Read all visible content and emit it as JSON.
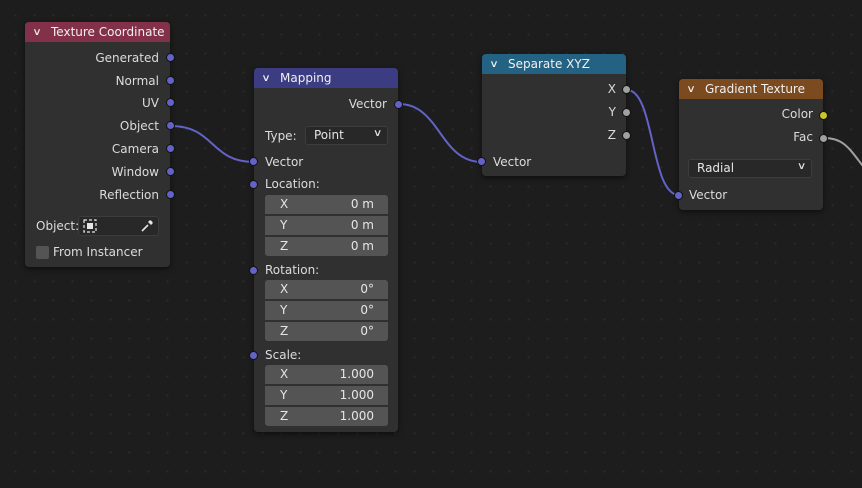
{
  "colors": {
    "texcoord_header": "#83314a",
    "mapping_header": "#3c3c83",
    "separate_header": "#246283",
    "gradient_header": "#7b4a1f",
    "vector_socket": "#6363c7",
    "float_socket": "#a1a1a1",
    "color_socket": "#c7c729",
    "link_vector": "#6363c7",
    "link_float": "#a1a1a1"
  },
  "nodes": {
    "texture_coordinate": {
      "title": "Texture Coordinate",
      "outputs": [
        "Generated",
        "Normal",
        "UV",
        "Object",
        "Camera",
        "Window",
        "Reflection"
      ],
      "object_label": "Object:",
      "object_icon": "object-icon",
      "eyedropper_icon": "eyedropper-icon",
      "from_instancer_label": "From Instancer",
      "from_instancer_checked": false
    },
    "mapping": {
      "title": "Mapping",
      "output": "Vector",
      "type_label": "Type:",
      "type_value": "Point",
      "input_vector": "Vector",
      "location_label": "Location:",
      "location": [
        {
          "axis": "X",
          "value": "0 m"
        },
        {
          "axis": "Y",
          "value": "0 m"
        },
        {
          "axis": "Z",
          "value": "0 m"
        }
      ],
      "rotation_label": "Rotation:",
      "rotation": [
        {
          "axis": "X",
          "value": "0°"
        },
        {
          "axis": "Y",
          "value": "0°"
        },
        {
          "axis": "Z",
          "value": "0°"
        }
      ],
      "scale_label": "Scale:",
      "scale": [
        {
          "axis": "X",
          "value": "1.000"
        },
        {
          "axis": "Y",
          "value": "1.000"
        },
        {
          "axis": "Z",
          "value": "1.000"
        }
      ]
    },
    "separate_xyz": {
      "title": "Separate XYZ",
      "outputs": [
        "X",
        "Y",
        "Z"
      ],
      "input": "Vector"
    },
    "gradient_texture": {
      "title": "Gradient Texture",
      "outputs": [
        "Color",
        "Fac"
      ],
      "type_value": "Radial",
      "input": "Vector"
    }
  }
}
